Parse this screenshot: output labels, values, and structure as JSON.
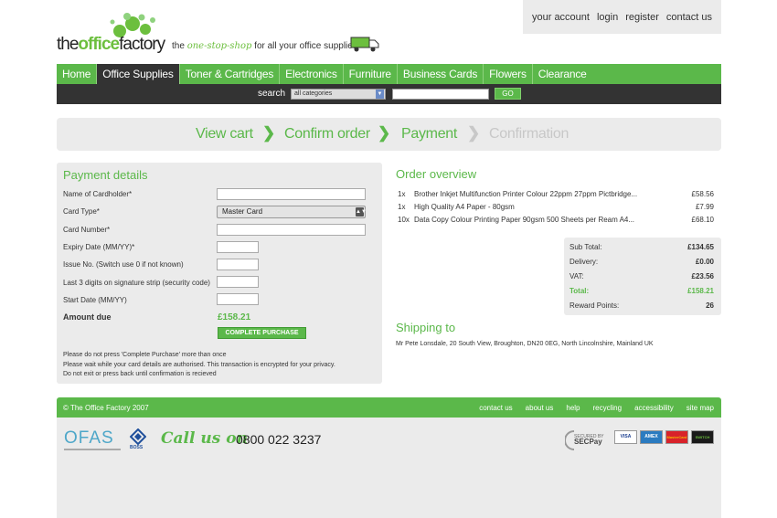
{
  "brand": {
    "logo_text_a": "the",
    "logo_text_b": "office",
    "logo_text_c": "factory",
    "tagline_pre": "the",
    "tagline_em": "one-stop-shop",
    "tagline_post": "for all your office supplies",
    "accent": "#5bb84a"
  },
  "account_links": [
    "your account",
    "login",
    "register",
    "contact us"
  ],
  "nav": {
    "items": [
      "Home",
      "Office Supplies",
      "Toner & Cartridges",
      "Electronics",
      "Furniture",
      "Business Cards",
      "Flowers",
      "Clearance"
    ],
    "active": "Office Supplies"
  },
  "search": {
    "label": "search",
    "category": "all categories",
    "button": "GO"
  },
  "steps": [
    {
      "label": "View cart",
      "state": "done"
    },
    {
      "label": "Confirm order",
      "state": "done"
    },
    {
      "label": "Payment",
      "state": "done"
    },
    {
      "label": "Confirmation",
      "state": "todo"
    }
  ],
  "payment": {
    "title": "Payment details",
    "fields": [
      {
        "label": "Name of Cardholder*",
        "type": "text"
      },
      {
        "label": "Card Type*",
        "type": "select",
        "value": "Master Card"
      },
      {
        "label": "Card Number*",
        "type": "text"
      },
      {
        "label": "Expiry Date (MM/YY)*",
        "type": "short"
      },
      {
        "label": "Issue No. (Switch use 0 if not known)",
        "type": "short"
      },
      {
        "label": "Last 3 digits on signature strip (security code)",
        "type": "short"
      },
      {
        "label": "Start Date (MM/YY)",
        "type": "short"
      }
    ],
    "amount_label": "Amount due",
    "amount_value": "£158.21",
    "button": "COMPLETE PURCHASE",
    "notes": [
      "Please do not press 'Complete Purchase' more than once",
      "Please wait while your card details are authorised. This transaction is encrypted for your privacy.",
      "Do not exit or press back until confirmation is recieved"
    ]
  },
  "overview": {
    "title": "Order overview",
    "items": [
      {
        "qty": "1x",
        "name": "Brother Inkjet Multifunction Printer Colour 22ppm 27ppm Pictbridge...",
        "price": "£58.56"
      },
      {
        "qty": "1x",
        "name": "High Quality A4 Paper - 80gsm",
        "price": "£7.99"
      },
      {
        "qty": "10x",
        "name": "Data Copy Colour Printing Paper 90gsm 500 Sheets per Ream A4...",
        "price": "£68.10"
      }
    ],
    "totals": [
      {
        "label": "Sub Total:",
        "value": "£134.65"
      },
      {
        "label": "Delivery:",
        "value": "£0.00"
      },
      {
        "label": "VAT:",
        "value": "£23.56"
      },
      {
        "label": "Total:",
        "value": "£158.21",
        "highlight": true
      },
      {
        "label": "Reward Points:",
        "value": "26"
      }
    ]
  },
  "shipping": {
    "title": "Shipping to",
    "address": "Mr Pete Lonsdale, 20 South View, Broughton, DN20 0EG, North Lincolnshire, Mainland UK"
  },
  "footer": {
    "copyright": "© The Office Factory 2007",
    "links": [
      "contact us",
      "about us",
      "help",
      "recycling",
      "accessibility",
      "site map"
    ],
    "ofas": "OFAS",
    "boss": "BOSS",
    "call": "Call us on",
    "phone": "0800 022 3237",
    "secpay_top": "SECURED BY",
    "secpay": "SECPay",
    "cards": [
      "VISA",
      "AMEX",
      "MasterCard",
      "SWITCH"
    ]
  }
}
